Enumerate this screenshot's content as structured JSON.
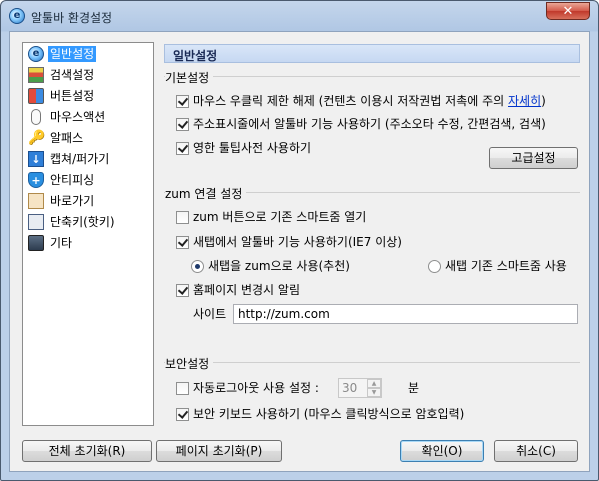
{
  "window": {
    "title": "알툴바 환경설정",
    "close": "✕"
  },
  "sidebar": {
    "items": [
      {
        "label": "일반설정",
        "icon": "general-settings-icon",
        "selected": true
      },
      {
        "label": "검색설정",
        "icon": "search-settings-icon"
      },
      {
        "label": "버튼설정",
        "icon": "button-settings-icon"
      },
      {
        "label": "마우스액션",
        "icon": "mouse-icon"
      },
      {
        "label": "알패스",
        "icon": "key-icon"
      },
      {
        "label": "캡쳐/퍼가기",
        "icon": "capture-icon"
      },
      {
        "label": "안티피싱",
        "icon": "shield-icon"
      },
      {
        "label": "바로가기",
        "icon": "shortcut-icon"
      },
      {
        "label": "단축키(핫키)",
        "icon": "hotkey-icon"
      },
      {
        "label": "기타",
        "icon": "etc-icon"
      }
    ]
  },
  "header": {
    "title": "일반설정"
  },
  "basic": {
    "label": "기본설정",
    "opt_mouse_pre": "마우스 우클릭 제한 해제 (컨텐츠 이용시 저작권법 저촉에 주의 ",
    "opt_mouse_link": "자세히",
    "opt_mouse_post": ")",
    "opt_addressbar": "주소표시줄에서 알툴바 기능 사용하기 (주소오타 수정, 간편검색, 검색)",
    "opt_tooltip": "영한 툴팁사전 사용하기",
    "advanced_btn": "고급설정"
  },
  "zum": {
    "label": "zum 연결 설정",
    "opt_button": "zum 버튼으로 기존 스마트줌 열기",
    "opt_newtab": "새탭에서 알툴바 기능 사용하기(IE7 이상)",
    "radio_zum": "새탭을 zum으로 사용(추천)",
    "radio_smart": "새탭 기존 스마트줌 사용",
    "opt_homepage": "홈페이지 변경시 알림",
    "site_label": "사이트",
    "site_value": "http://zum.com"
  },
  "security": {
    "label": "보안설정",
    "opt_autologout": "자동로그아웃 사용 설정 :",
    "autologout_value": "30",
    "autologout_unit": "분",
    "opt_keyboard": "보안 키보드 사용하기 (마우스 클릭방식으로 암호입력)"
  },
  "footer": {
    "reset_all": "전체 초기화(R)",
    "reset_page": "페이지 초기화(P)",
    "ok": "확인(O)",
    "cancel": "취소(C)"
  },
  "colors": {
    "accent": "#3399ff",
    "title_bg": "#bcd0e9",
    "close": "#c0392b"
  }
}
